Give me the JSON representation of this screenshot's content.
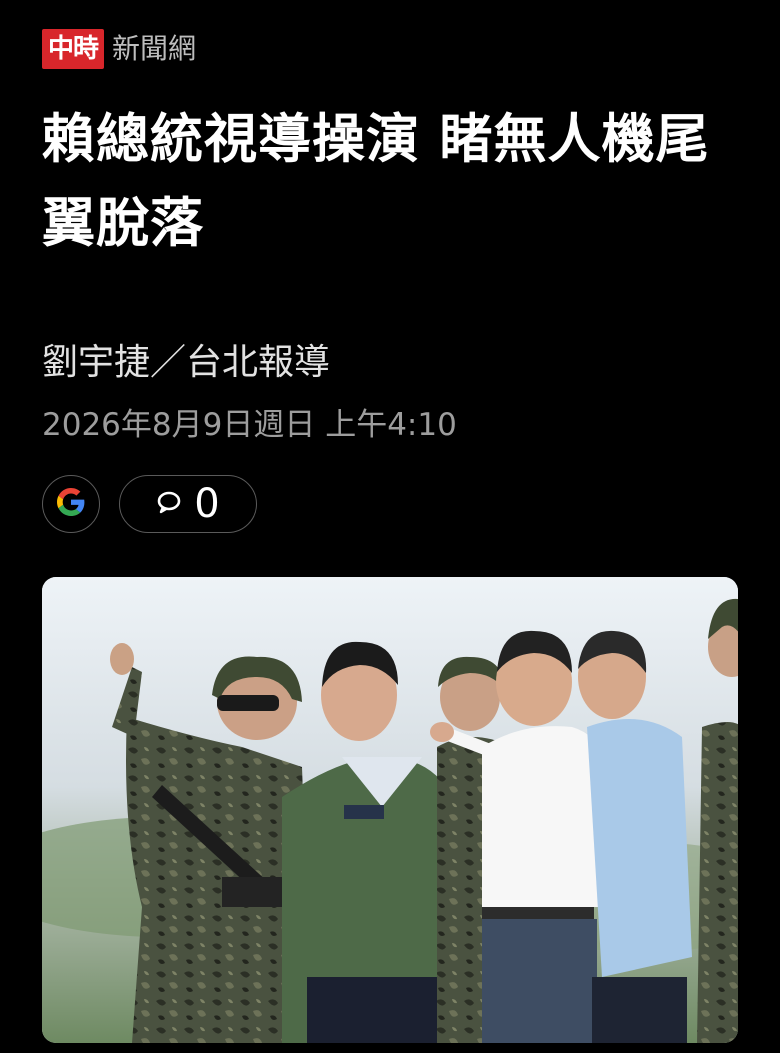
{
  "article": {
    "source_logo": "中時",
    "source_name": "新聞網",
    "headline": "賴總統視導操演 睹無人機尾翼脫落",
    "byline": "劉宇捷／台北報導",
    "datetime": "2026年8月9日週日 上午4:10",
    "comment_count": "0"
  },
  "icons": {
    "google": "google-logo-icon",
    "comment": "speech-bubble-icon"
  },
  "colors": {
    "background": "#000000",
    "brand_red": "#d8262b",
    "text_primary": "#ffffff",
    "text_secondary": "#9d9d9d"
  }
}
